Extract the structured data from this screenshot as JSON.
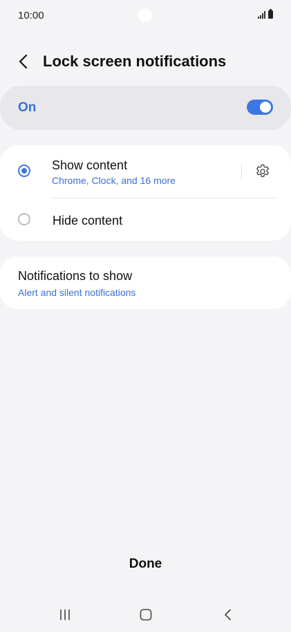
{
  "status_bar": {
    "time": "10:00"
  },
  "header": {
    "title": "Lock screen notifications",
    "back_icon": "chevron-left-icon"
  },
  "master_toggle": {
    "label": "On",
    "checked": true,
    "accent_color": "#3d77e6"
  },
  "options": [
    {
      "title": "Show content",
      "subtitle": "Chrome, Clock, and 16 more",
      "selected": true,
      "settings_icon": "gear-icon"
    },
    {
      "title": "Hide content",
      "selected": false
    }
  ],
  "notifications_to_show": {
    "title": "Notifications to show",
    "value": "Alert and silent notifications"
  },
  "footer": {
    "done_label": "Done"
  },
  "nav_bar": {
    "icons": [
      "recent-apps-icon",
      "home-icon",
      "back-icon"
    ]
  }
}
